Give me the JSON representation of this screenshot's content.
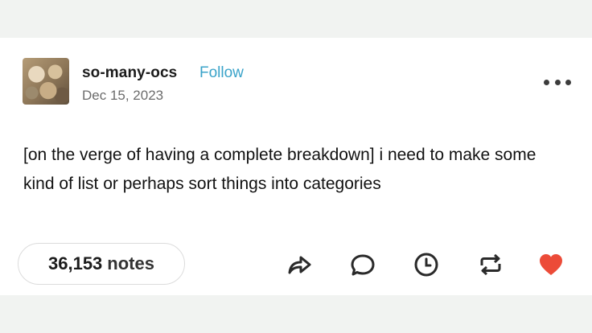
{
  "post": {
    "username": "so-many-ocs",
    "follow_label": "Follow",
    "date": "Dec 15, 2023",
    "body": "[on the verge of having a complete breakdown] i need to make some kind of list or perhaps sort things into categories",
    "notes_count": "36,153",
    "notes_label": "notes"
  },
  "icons": {
    "more": "more-options-icon",
    "share": "share-icon",
    "reply": "reply-icon",
    "queue": "clock-icon",
    "reblog": "reblog-icon",
    "like": "heart-icon"
  },
  "colors": {
    "follow": "#3aa3c9",
    "like": "#ec4b38",
    "background": "#f1f3f1"
  }
}
